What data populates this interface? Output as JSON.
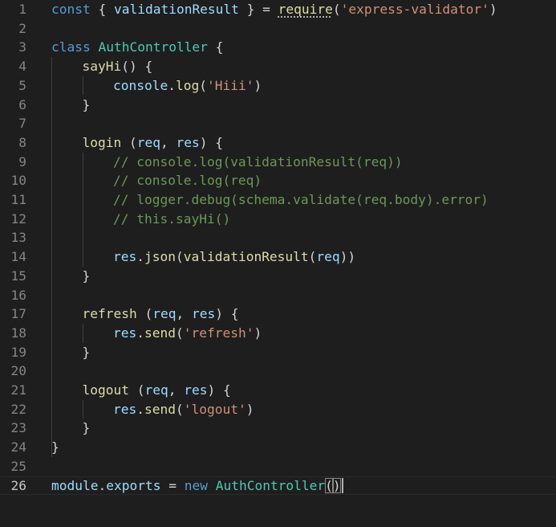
{
  "editor": {
    "language": "javascript",
    "current_line": 26,
    "colors": {
      "background": "#1e1e1e",
      "keyword": "#569cd6",
      "class": "#4ec9b0",
      "variable": "#9cdcfe",
      "function": "#dcdcaa",
      "string": "#ce9178",
      "comment": "#6a9955",
      "text": "#d4d4d4",
      "line_number": "#858585"
    },
    "lines": [
      {
        "n": "1",
        "indent": 0,
        "tokens": [
          {
            "t": "const",
            "k": "kw"
          },
          {
            "t": " { ",
            "k": "punc"
          },
          {
            "t": "validationResult",
            "k": "var"
          },
          {
            "t": " } = ",
            "k": "punc"
          },
          {
            "t": "require",
            "k": "fn",
            "squiggle": true
          },
          {
            "t": "(",
            "k": "punc"
          },
          {
            "t": "'express-validator'",
            "k": "str"
          },
          {
            "t": ")",
            "k": "punc"
          }
        ]
      },
      {
        "n": "2",
        "indent": 0,
        "tokens": []
      },
      {
        "n": "3",
        "indent": 0,
        "tokens": [
          {
            "t": "class",
            "k": "kw"
          },
          {
            "t": " ",
            "k": "punc"
          },
          {
            "t": "AuthController",
            "k": "cls"
          },
          {
            "t": " {",
            "k": "punc"
          }
        ]
      },
      {
        "n": "4",
        "indent": 1,
        "tokens": [
          {
            "t": "sayHi",
            "k": "fn"
          },
          {
            "t": "() {",
            "k": "punc"
          }
        ]
      },
      {
        "n": "5",
        "indent": 2,
        "tokens": [
          {
            "t": "console",
            "k": "var"
          },
          {
            "t": ".",
            "k": "punc"
          },
          {
            "t": "log",
            "k": "fn"
          },
          {
            "t": "(",
            "k": "punc"
          },
          {
            "t": "'Hiii'",
            "k": "str"
          },
          {
            "t": ")",
            "k": "punc"
          }
        ]
      },
      {
        "n": "6",
        "indent": 1,
        "tokens": [
          {
            "t": "}",
            "k": "punc"
          }
        ]
      },
      {
        "n": "7",
        "indent": 0,
        "tokens": []
      },
      {
        "n": "8",
        "indent": 1,
        "tokens": [
          {
            "t": "login",
            "k": "fn"
          },
          {
            "t": " (",
            "k": "punc"
          },
          {
            "t": "req",
            "k": "var"
          },
          {
            "t": ", ",
            "k": "punc"
          },
          {
            "t": "res",
            "k": "var"
          },
          {
            "t": ") {",
            "k": "punc"
          }
        ]
      },
      {
        "n": "9",
        "indent": 2,
        "tokens": [
          {
            "t": "// console.log(validationResult(req))",
            "k": "com"
          }
        ]
      },
      {
        "n": "10",
        "indent": 2,
        "tokens": [
          {
            "t": "// console.log(req)",
            "k": "com"
          }
        ]
      },
      {
        "n": "11",
        "indent": 2,
        "tokens": [
          {
            "t": "// logger.debug(schema.validate(req.body).error)",
            "k": "com"
          }
        ]
      },
      {
        "n": "12",
        "indent": 2,
        "tokens": [
          {
            "t": "// this.sayHi()",
            "k": "com"
          }
        ]
      },
      {
        "n": "13",
        "indent": 0,
        "tokens": []
      },
      {
        "n": "14",
        "indent": 2,
        "tokens": [
          {
            "t": "res",
            "k": "var"
          },
          {
            "t": ".",
            "k": "punc"
          },
          {
            "t": "json",
            "k": "fn"
          },
          {
            "t": "(",
            "k": "punc"
          },
          {
            "t": "validationResult",
            "k": "fn"
          },
          {
            "t": "(",
            "k": "punc"
          },
          {
            "t": "req",
            "k": "var"
          },
          {
            "t": "))",
            "k": "punc"
          }
        ]
      },
      {
        "n": "15",
        "indent": 1,
        "tokens": [
          {
            "t": "}",
            "k": "punc"
          }
        ]
      },
      {
        "n": "16",
        "indent": 0,
        "tokens": []
      },
      {
        "n": "17",
        "indent": 1,
        "tokens": [
          {
            "t": "refresh",
            "k": "fn"
          },
          {
            "t": " (",
            "k": "punc"
          },
          {
            "t": "req",
            "k": "var"
          },
          {
            "t": ", ",
            "k": "punc"
          },
          {
            "t": "res",
            "k": "var"
          },
          {
            "t": ") {",
            "k": "punc"
          }
        ]
      },
      {
        "n": "18",
        "indent": 2,
        "tokens": [
          {
            "t": "res",
            "k": "var"
          },
          {
            "t": ".",
            "k": "punc"
          },
          {
            "t": "send",
            "k": "fn"
          },
          {
            "t": "(",
            "k": "punc"
          },
          {
            "t": "'refresh'",
            "k": "str"
          },
          {
            "t": ")",
            "k": "punc"
          }
        ]
      },
      {
        "n": "19",
        "indent": 1,
        "tokens": [
          {
            "t": "}",
            "k": "punc"
          }
        ]
      },
      {
        "n": "20",
        "indent": 0,
        "tokens": []
      },
      {
        "n": "21",
        "indent": 1,
        "tokens": [
          {
            "t": "logout",
            "k": "fn"
          },
          {
            "t": " (",
            "k": "punc"
          },
          {
            "t": "req",
            "k": "var"
          },
          {
            "t": ", ",
            "k": "punc"
          },
          {
            "t": "res",
            "k": "var"
          },
          {
            "t": ") {",
            "k": "punc"
          }
        ]
      },
      {
        "n": "22",
        "indent": 2,
        "tokens": [
          {
            "t": "res",
            "k": "var"
          },
          {
            "t": ".",
            "k": "punc"
          },
          {
            "t": "send",
            "k": "fn"
          },
          {
            "t": "(",
            "k": "punc"
          },
          {
            "t": "'logout'",
            "k": "str"
          },
          {
            "t": ")",
            "k": "punc"
          }
        ]
      },
      {
        "n": "23",
        "indent": 1,
        "tokens": [
          {
            "t": "}",
            "k": "punc"
          }
        ]
      },
      {
        "n": "24",
        "indent": 0,
        "tokens": [
          {
            "t": "}",
            "k": "punc"
          }
        ]
      },
      {
        "n": "25",
        "indent": 0,
        "tokens": []
      },
      {
        "n": "26",
        "indent": 0,
        "tokens": [
          {
            "t": "module",
            "k": "var"
          },
          {
            "t": ".",
            "k": "punc"
          },
          {
            "t": "exports",
            "k": "var"
          },
          {
            "t": " = ",
            "k": "punc"
          },
          {
            "t": "new",
            "k": "kw"
          },
          {
            "t": " ",
            "k": "punc"
          },
          {
            "t": "AuthController",
            "k": "cls"
          },
          {
            "t": "(",
            "k": "punc",
            "bracket": true
          },
          {
            "t": ")",
            "k": "punc",
            "bracket": true
          }
        ]
      }
    ]
  }
}
